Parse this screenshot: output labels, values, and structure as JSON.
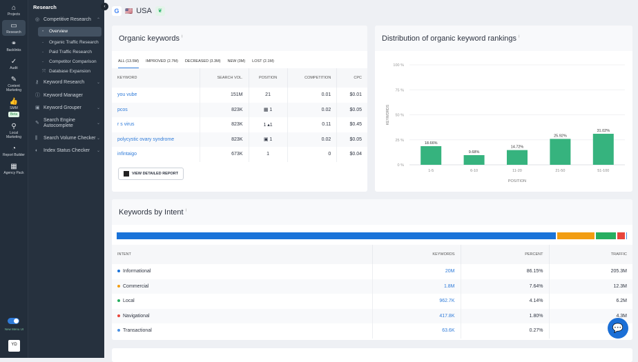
{
  "rail": [
    {
      "label": "Projects",
      "icon": "home-icon"
    },
    {
      "label": "Research",
      "icon": "laptop-icon",
      "active": true
    },
    {
      "label": "Backlinks",
      "icon": "link-icon"
    },
    {
      "label": "Audit",
      "icon": "check-circle-icon"
    },
    {
      "label": "Content Marketing",
      "icon": "edit-icon"
    },
    {
      "label": "SMM",
      "icon": "thumbs-up-icon",
      "badge": "Beta"
    },
    {
      "label": "Local Marketing",
      "icon": "pin-icon"
    },
    {
      "label": "Report Builder",
      "icon": "pie-icon"
    },
    {
      "label": "Agency Pack",
      "icon": "building-icon"
    }
  ],
  "toggle_label": "New Menu UI",
  "avatar": "YD",
  "sidebar": {
    "title": "Research",
    "competitive": {
      "label": "Competitive Research",
      "subs": [
        "Overview",
        "Organic Traffic Research",
        "Paid Traffic Research",
        "Competitor Comparison",
        "Database Expansion"
      ]
    },
    "items": [
      "Keyword Research",
      "Keyword Manager",
      "Keyword Grouper",
      "Search Engine Autocomplete",
      "Search Volume Checker",
      "Index Status Checker"
    ]
  },
  "topbar": {
    "engine": "G",
    "flag": "🇺🇸",
    "country": "USA"
  },
  "organic": {
    "title": "Organic keywords",
    "tabs": [
      "ALL (13.5M)",
      "IMPROVED (2.7M)",
      "DECREASED (3.3M)",
      "NEW (3M)",
      "LOST (2.1M)"
    ],
    "headers": [
      "KEYWORD",
      "SEARCH VOL.",
      "POSITION",
      "COMPETITION",
      "CPC"
    ],
    "rows": [
      [
        "you vube",
        "151M",
        "21",
        "0.01",
        "$0.01"
      ],
      [
        "pcos",
        "823K",
        "▦ 1",
        "0.02",
        "$0.05"
      ],
      [
        "r s virus",
        "823K",
        "1 ▴1",
        "0.11",
        "$0.45"
      ],
      [
        "polycystic ovary syndrome",
        "823K",
        "▣ 1",
        "0.02",
        "$0.05"
      ],
      [
        "infintaigo",
        "673K",
        "1",
        "0",
        "$0.04"
      ]
    ],
    "button": "VIEW DETAILED REPORT"
  },
  "distribution": {
    "title": "Distribution of organic keyword rankings"
  },
  "chart_data": {
    "type": "bar",
    "categories": [
      "1-5",
      "6-10",
      "11-20",
      "21-50",
      "51-100"
    ],
    "values": [
      18.66,
      9.68,
      14.72,
      25.92,
      31.02
    ],
    "data_labels": [
      "18.66%",
      "9.68%",
      "14.72%",
      "25.92%",
      "31.02%"
    ],
    "xlabel": "POSITION",
    "ylabel": "KEYWORDS",
    "ylim": [
      0,
      100
    ],
    "yticks": [
      "0 %",
      "25 %",
      "50 %",
      "75 %",
      "100 %"
    ],
    "grid": true,
    "color": "#36b37e"
  },
  "intent": {
    "title": "Keywords by Intent",
    "headers": [
      "INTENT",
      "KEYWORDS",
      "PERCENT",
      "TRAFFIC"
    ],
    "rows": [
      {
        "name": "Informational",
        "keywords": "20M",
        "percent": "86.15%",
        "traffic": "205.3M",
        "color": "#1a73d9",
        "share": 86.15
      },
      {
        "name": "Commercial",
        "keywords": "1.8M",
        "percent": "7.64%",
        "traffic": "12.3M",
        "color": "#f29d12",
        "share": 7.64
      },
      {
        "name": "Local",
        "keywords": "962.7K",
        "percent": "4.14%",
        "traffic": "6.2M",
        "color": "#27ae60",
        "share": 4.14
      },
      {
        "name": "Navigational",
        "keywords": "417.8K",
        "percent": "1.80%",
        "traffic": "4.3M",
        "color": "#e8453c",
        "share": 1.8
      },
      {
        "name": "Transactional",
        "keywords": "63.6K",
        "percent": "0.27%",
        "traffic": "",
        "color": "#4a90e2",
        "share": 0.27
      }
    ]
  }
}
